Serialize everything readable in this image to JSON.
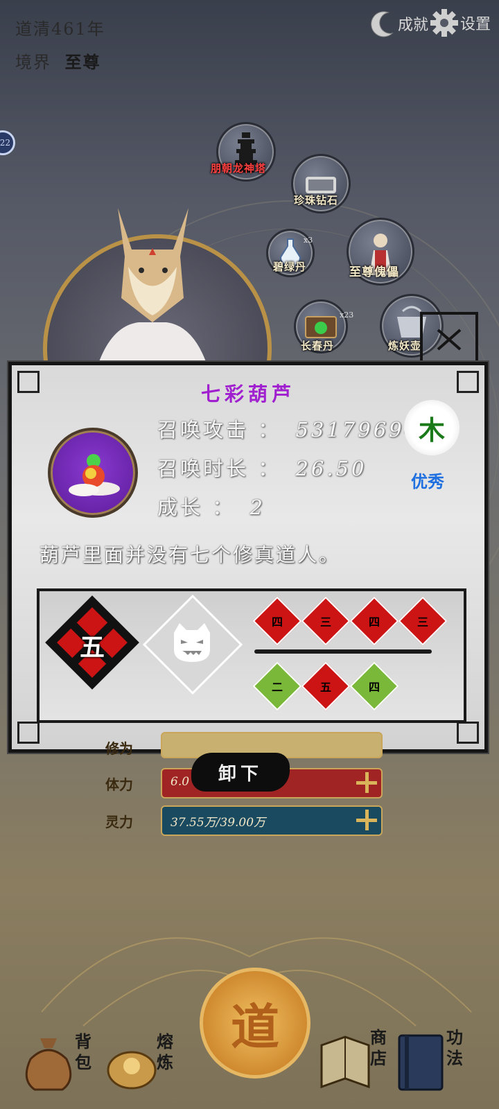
{
  "hud": {
    "year_label": "道清461年",
    "realm_label": "境界",
    "realm_value": "至尊",
    "achievements_label": "成就",
    "settings_label": "设置",
    "side_badge": "22"
  },
  "bubbles": [
    {
      "label": "朋朝龙神塔",
      "icon": "pagoda-icon"
    },
    {
      "label": "珍珠钻石",
      "icon": "treasure-icon"
    },
    {
      "label": "碧绿丹",
      "icon": "potion-icon",
      "count": "x3"
    },
    {
      "label": "至尊傀儡",
      "icon": "puppet-icon"
    },
    {
      "label": "长春丹",
      "icon": "chest-icon",
      "count": "x23"
    },
    {
      "label": "炼妖壶",
      "icon": "pot-icon"
    }
  ],
  "popup": {
    "title": "七彩葫芦",
    "summon_attack_label": "召唤攻击 ：",
    "summon_attack_value": "531796948",
    "summon_duration_label": "召唤时长 ：",
    "summon_duration_value": "26.50",
    "growth_label": "成长 ：",
    "growth_value": "2",
    "description": "葫芦里面并没有七个修真道人。",
    "element": "木",
    "quality": "优秀",
    "main_rune": "五",
    "small_runes_top": [
      "四",
      "三",
      "四",
      "三"
    ],
    "small_runes_bottom": [
      "二",
      "五",
      "四"
    ]
  },
  "unload_label": "卸下",
  "stats": {
    "row1_label": "修为",
    "hp_label": "体力",
    "hp_value": "6.0",
    "mp_label": "灵力",
    "mp_value": "37.55万/39.00万"
  },
  "nav": {
    "bag": "背包",
    "forge": "熔炼",
    "dao": "道",
    "shop": "商店",
    "skills": "功法"
  },
  "colors": {
    "title_purple": "#a020d0",
    "quality_blue": "#1e6fe0",
    "element_green": "#1a7a1a",
    "rune_red": "#cc1414",
    "rune_green": "#7ab83a"
  }
}
